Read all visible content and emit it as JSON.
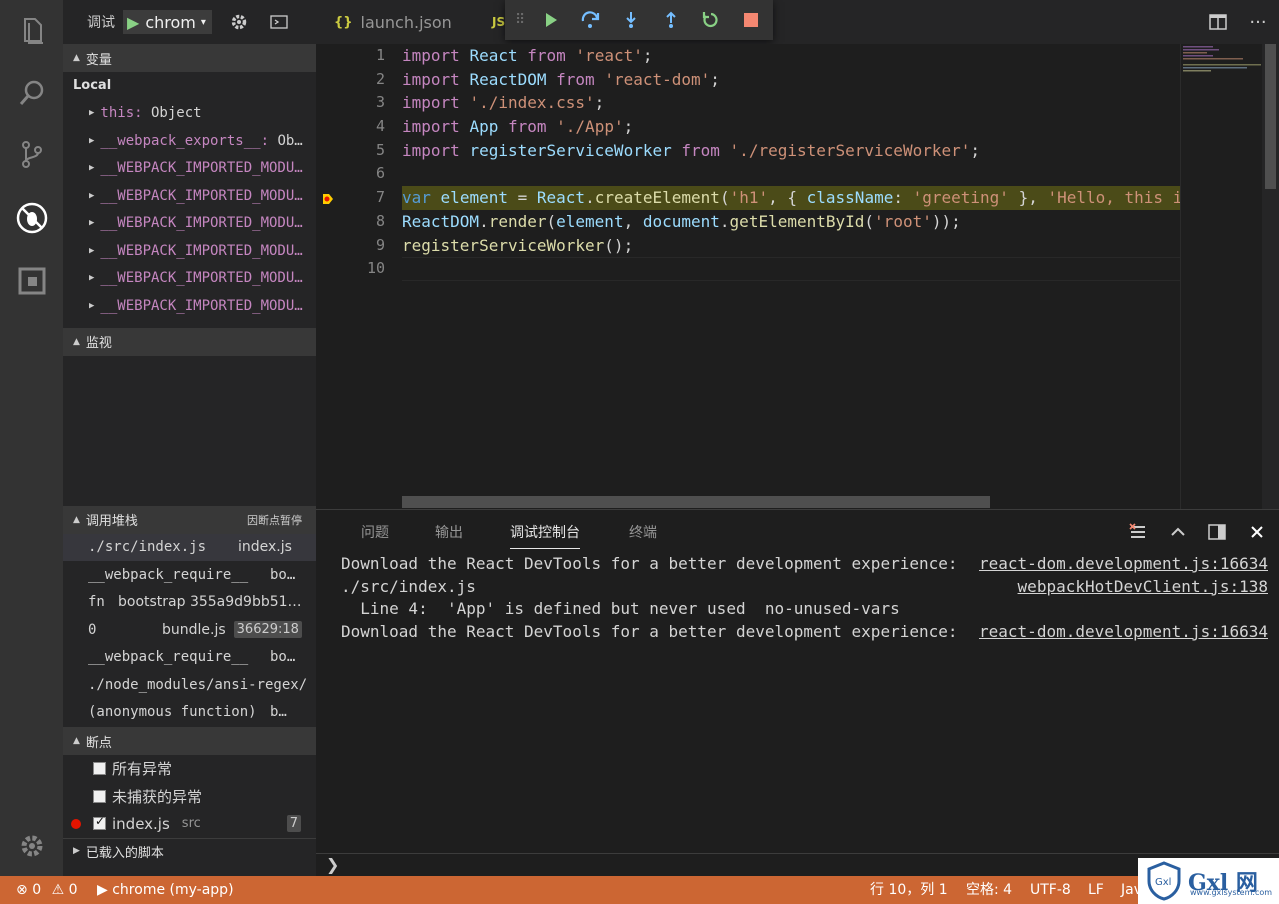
{
  "activity_bar": {
    "icons": [
      "files-icon",
      "search-icon",
      "source-control-icon",
      "debug-icon",
      "extensions-icon",
      "settings-gear-icon"
    ]
  },
  "debug_toolbar": {
    "label": "调试",
    "config": "chrom",
    "play_icon": "▶",
    "caret": "▾"
  },
  "variables": {
    "header": "变量",
    "scope": "Local",
    "items": [
      {
        "name": "this",
        "value": "Object"
      },
      {
        "name": "__webpack_exports__",
        "value": "Ob…"
      },
      {
        "name": "__WEBPACK_IMPORTED_MODU…",
        "value": ""
      },
      {
        "name": "__WEBPACK_IMPORTED_MODU…",
        "value": ""
      },
      {
        "name": "__WEBPACK_IMPORTED_MODU…",
        "value": ""
      },
      {
        "name": "__WEBPACK_IMPORTED_MODU…",
        "value": ""
      },
      {
        "name": "__WEBPACK_IMPORTED_MODU…",
        "value": ""
      },
      {
        "name": "__WEBPACK_IMPORTED_MODU…",
        "value": ""
      }
    ]
  },
  "watch": {
    "header": "监视"
  },
  "call_stack": {
    "header": "调用堆栈",
    "status": "因断点暂停",
    "frames": [
      {
        "fn": "./src/index.js",
        "file": "index.js",
        "badge": ""
      },
      {
        "fn": "__webpack_require__",
        "file": "bo…",
        "badge": ""
      },
      {
        "fn": "fn",
        "file": "bootstrap 355a9d9bb51…",
        "badge": ""
      },
      {
        "fn": "0",
        "file": "bundle.js",
        "badge": "36629:18"
      },
      {
        "fn": "__webpack_require__",
        "file": "bo…",
        "badge": ""
      },
      {
        "fn": "./node_modules/ansi-regex/",
        "file": "",
        "badge": ""
      },
      {
        "fn": "(anonymous function)",
        "file": "b…",
        "badge": ""
      }
    ]
  },
  "breakpoints": {
    "header": "断点",
    "items": [
      {
        "label": "所有异常",
        "checked": false,
        "src": "",
        "count": ""
      },
      {
        "label": "未捕获的异常",
        "checked": false,
        "src": "",
        "count": ""
      },
      {
        "label": "index.js",
        "checked": true,
        "src": "src",
        "count": "7"
      }
    ],
    "loaded_scripts": "已载入的脚本"
  },
  "tabs": [
    {
      "icon": "{}",
      "label": "launch.json"
    },
    {
      "icon": "JS",
      "label": ""
    }
  ],
  "editor": {
    "line_numbers": [
      "1",
      "2",
      "3",
      "4",
      "5",
      "6",
      "7",
      "8",
      "9",
      "10"
    ]
  },
  "panel": {
    "tabs": [
      "问题",
      "输出",
      "调试控制台",
      "终端"
    ],
    "active_tab": "调试控制台",
    "lines": [
      {
        "text": "Download the React DevTools for a better development experience:",
        "source": "react-dom.development.js:16634"
      },
      {
        "text": "./src/index.js",
        "source": "webpackHotDevClient.js:138"
      },
      {
        "text": "  Line 4:  'App' is defined but never used  no-unused-vars",
        "source": ""
      },
      {
        "text": "Download the React DevTools for a better development experience:",
        "source": "react-dom.development.js:16634"
      }
    ],
    "prompt": "❯"
  },
  "status_bar": {
    "errors": "0",
    "warnings": "0",
    "session": "chrome (my-app)",
    "position": "行 10，列 1",
    "spaces": "空格: 4",
    "encoding": "UTF-8",
    "eol": "LF",
    "language": "Jav"
  },
  "watermark": {
    "text": "Gxl 网",
    "sub": "www.gxlsystem.com"
  },
  "colors": {
    "accent": "#cc6633",
    "debug_green": "#89d185",
    "breakpoint_red": "#e51400",
    "highlight_line": "#4b4b18"
  }
}
